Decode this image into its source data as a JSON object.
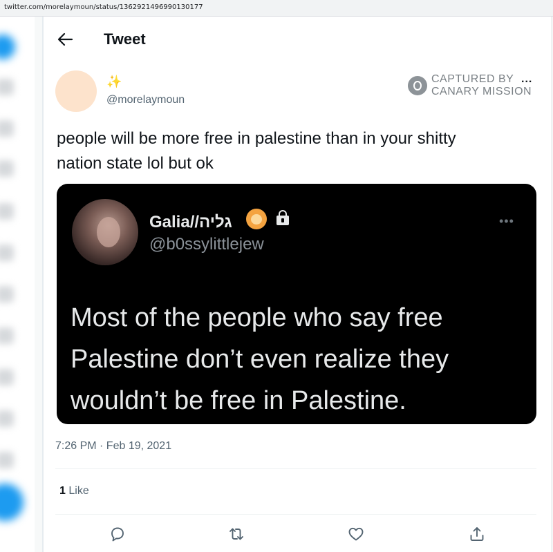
{
  "browser": {
    "url": "twitter.com/morelaymoun/status/1362921496990130177"
  },
  "header": {
    "title": "Tweet"
  },
  "author": {
    "display_name": "✨",
    "handle": "@morelaymoun"
  },
  "watermark": {
    "line1": "CAPTURED BY",
    "line2": "CANARY MISSION"
  },
  "more_menu": "...",
  "tweet": {
    "text_line1": "people will be more free in palestine than in your shitty",
    "text_line2": "nation state lol but ok"
  },
  "embedded_screenshot": {
    "name": "Galia//גליה",
    "handle": "@b0ssylittlejew",
    "more": "•••",
    "text_line1": "Most of the people who say free",
    "text_line2": "Palestine don’t even realize they",
    "text_line3": "wouldn’t be free in Palestine."
  },
  "meta": {
    "timestamp": "7:26 PM · Feb 19, 2021",
    "like_count": "1",
    "like_label": "Like"
  },
  "icons": {
    "back": "arrow-left-icon",
    "reply": "reply-icon",
    "retweet": "retweet-icon",
    "like": "heart-icon",
    "share": "share-icon"
  },
  "colors": {
    "text": "#0f1419",
    "secondary_text": "#536471",
    "embed_bg": "#000000",
    "watermark": "#7a8085"
  }
}
